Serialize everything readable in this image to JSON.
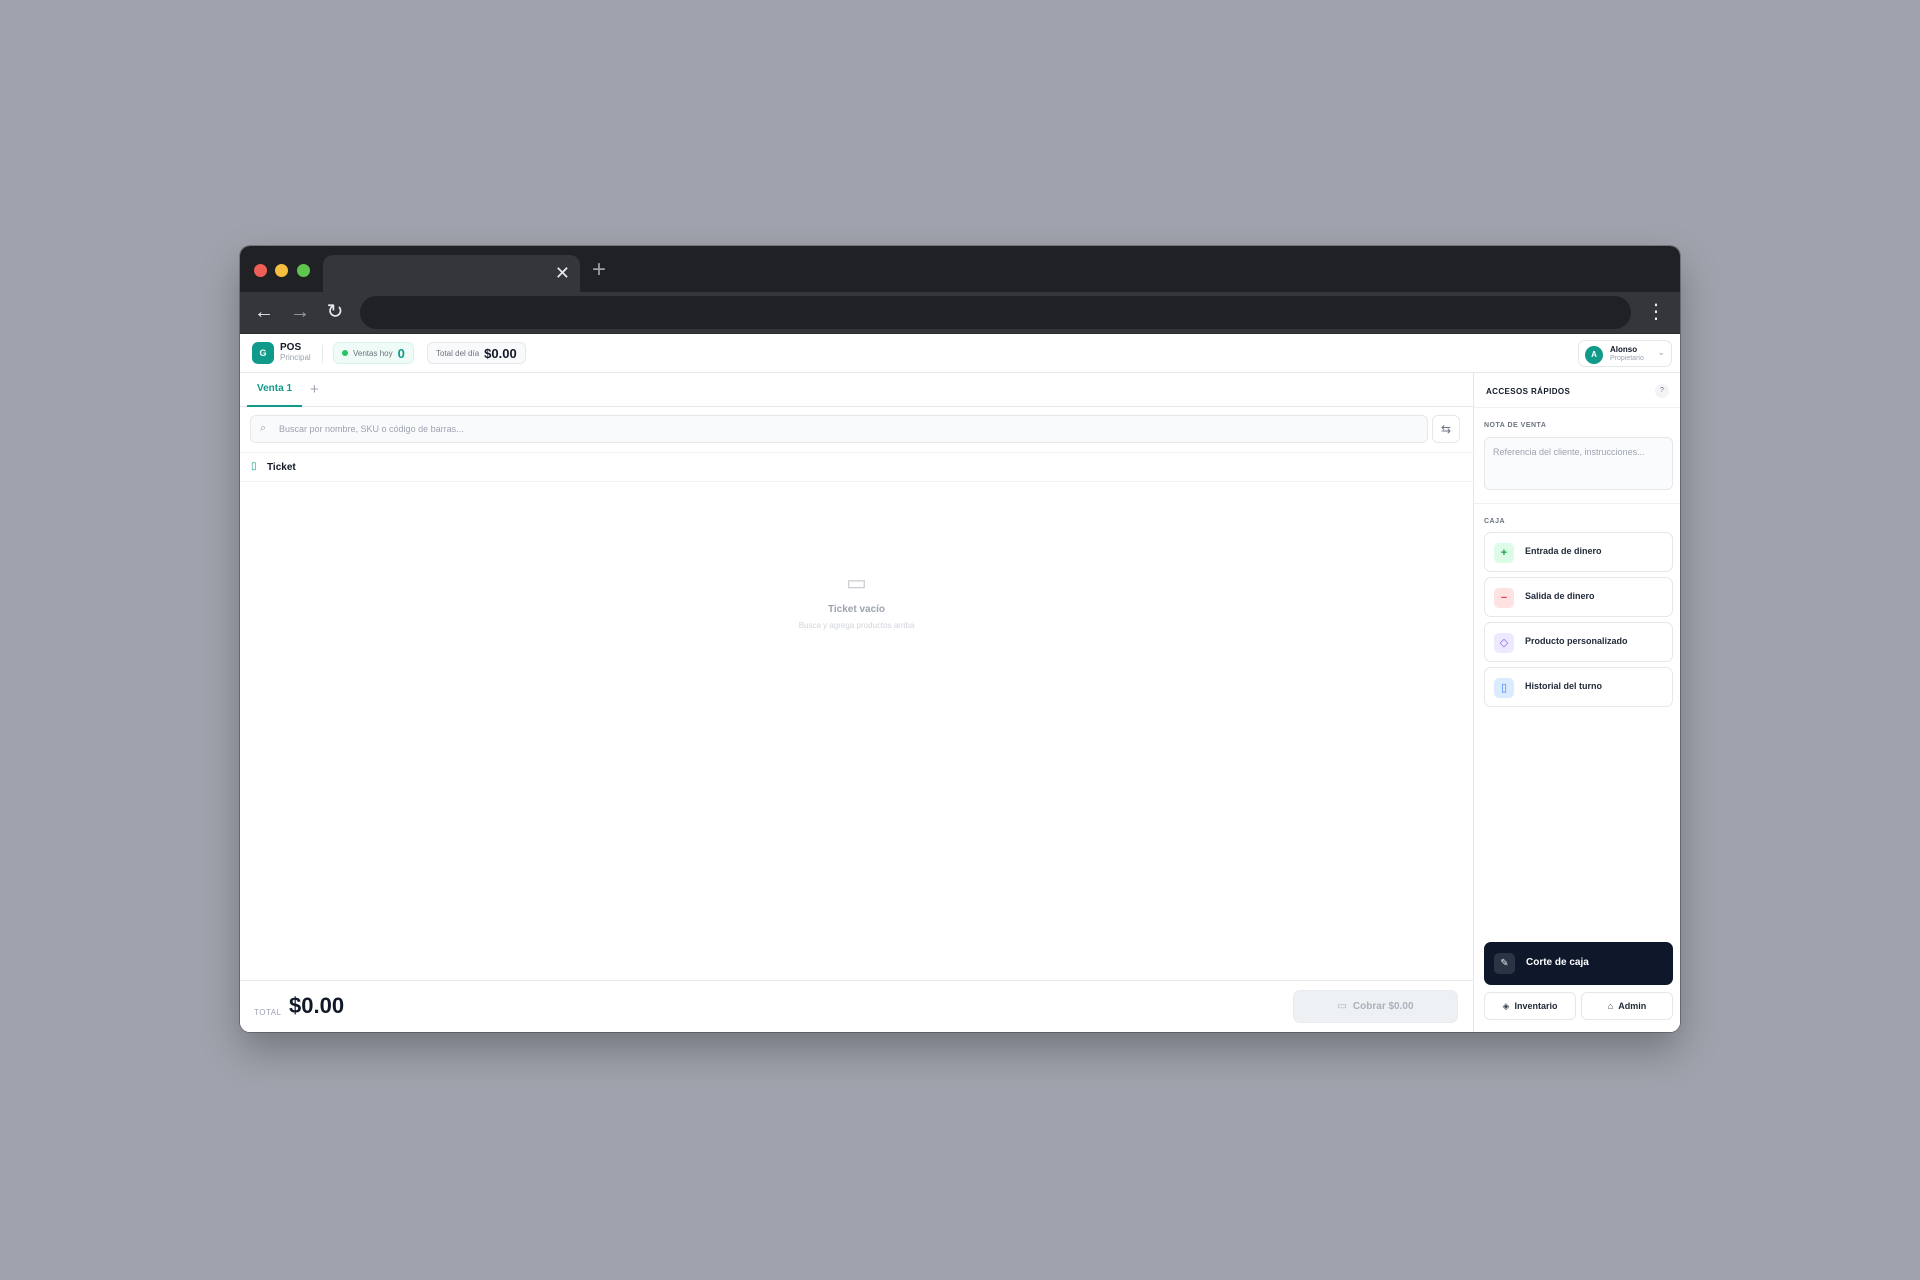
{
  "browser": {
    "tab_close": "✕",
    "new_tab": "+",
    "back": "←",
    "forward": "→",
    "reload": "↻",
    "menu": "⋮"
  },
  "header": {
    "logo_letter": "G",
    "app_title": "POS",
    "app_subtitle": "Principal",
    "sales_today_label": "Ventas hoy",
    "sales_today_count": "0",
    "day_total_label": "Total del día",
    "day_total_amount": "$0.00",
    "user_initial": "A",
    "user_name": "Alonso",
    "user_role": "Propietario"
  },
  "sale_tabs": {
    "active_label": "Venta 1",
    "add_label": "+"
  },
  "search": {
    "placeholder": "Buscar por nombre, SKU o código de barras..."
  },
  "ticket": {
    "title": "Ticket",
    "empty_title": "Ticket vacío",
    "empty_subtitle": "Busca y agrega productos arriba"
  },
  "footer": {
    "total_label": "TOTAL",
    "total_amount": "$0.00",
    "charge_label": "Cobrar $0.00"
  },
  "sidebar": {
    "title": "ACCESOS RÁPIDOS",
    "help": "?",
    "note_label": "NOTA DE VENTA",
    "note_placeholder": "Referencia del cliente, instrucciones...",
    "cash_label": "CAJA",
    "cash_actions": [
      {
        "label": "Entrada de dinero",
        "icon": "plus-icon",
        "color": "#16a34a"
      },
      {
        "label": "Salida de dinero",
        "icon": "minus-icon",
        "color": "#ef4444"
      },
      {
        "label": "Producto personalizado",
        "icon": "tag-icon",
        "color": "#8b5cf6"
      },
      {
        "label": "Historial del turno",
        "icon": "clipboard-icon",
        "color": "#3b82f6"
      }
    ],
    "cut_label": "Corte de caja",
    "inventory_label": "Inventario",
    "admin_label": "Admin"
  },
  "colors": {
    "accent": "#0f9a8a",
    "dark_button": "#0f172a",
    "backdrop": "#a0a3ad"
  }
}
